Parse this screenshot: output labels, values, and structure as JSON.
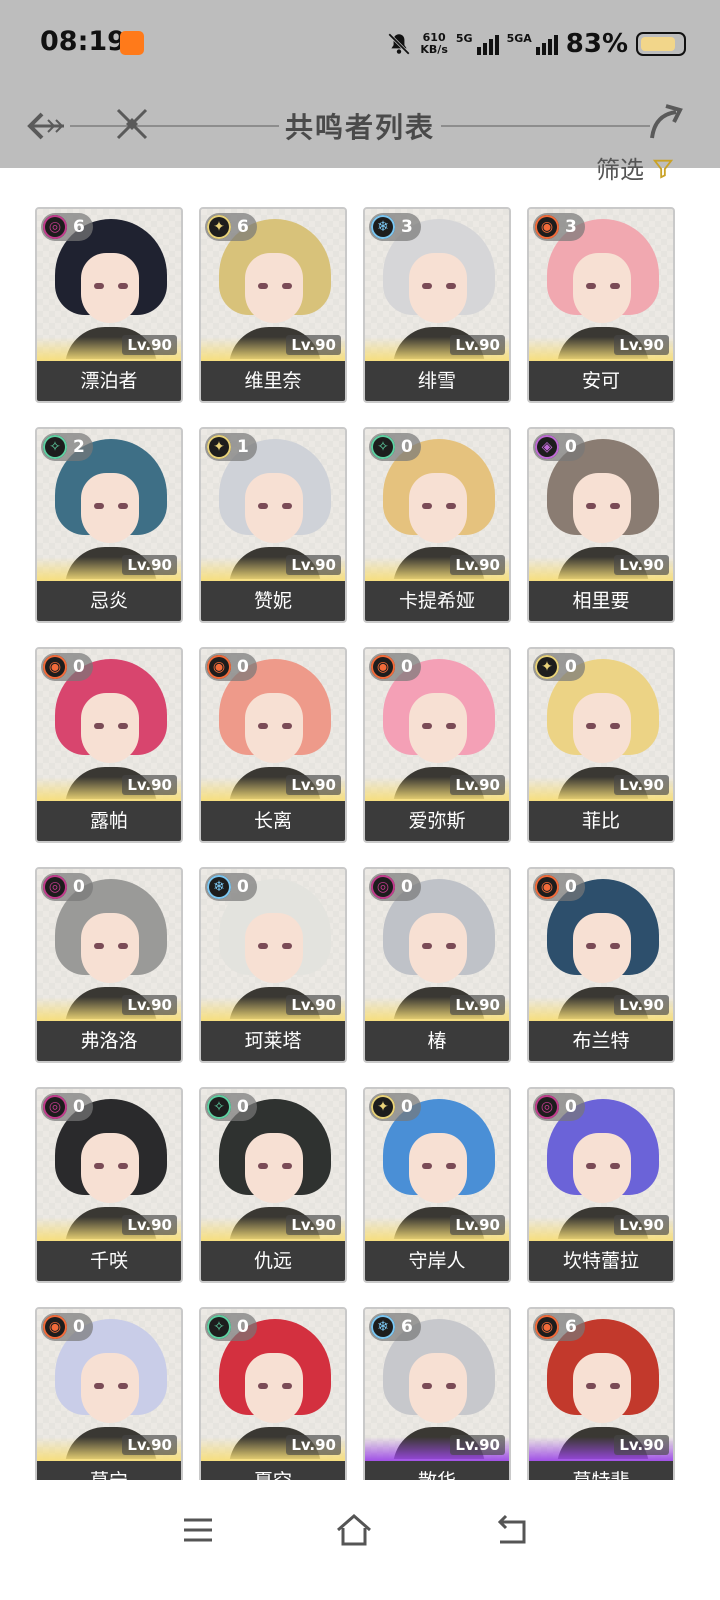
{
  "status_bar": {
    "time": "08:19",
    "net_speed": "610",
    "net_unit": "KB/s",
    "signal1_label": "5G",
    "signal2_label": "5GA",
    "battery_text": "83%",
    "icons": [
      "taobao-app-icon",
      "mute-bell-icon",
      "signal-icon",
      "battery-icon"
    ]
  },
  "header": {
    "title": "共鸣者列表",
    "filter_label": "筛选"
  },
  "level_prefix": "Lv.90",
  "attribute_colors": {
    "spectro": "#e8d27a",
    "glacio": "#7cc7f2",
    "fusion": "#f26b3a",
    "electro": "#c06bd6",
    "aero": "#5fd0a2",
    "havoc": "#c13c8c"
  },
  "characters": [
    {
      "name": "漂泊者",
      "attribute": "havoc",
      "chain": "6",
      "level": "Lv.90",
      "hair": "#1f2230",
      "rarity": "gold"
    },
    {
      "name": "维里奈",
      "attribute": "spectro",
      "chain": "6",
      "level": "Lv.90",
      "hair": "#d8c27a",
      "rarity": "gold"
    },
    {
      "name": "绯雪",
      "attribute": "glacio",
      "chain": "3",
      "level": "Lv.90",
      "hair": "#d6d6d8",
      "rarity": "gold"
    },
    {
      "name": "安可",
      "attribute": "fusion",
      "chain": "3",
      "level": "Lv.90",
      "hair": "#f1a8b0",
      "rarity": "gold"
    },
    {
      "name": "忌炎",
      "attribute": "aero",
      "chain": "2",
      "level": "Lv.90",
      "hair": "#3e6f86",
      "rarity": "gold"
    },
    {
      "name": "赞妮",
      "attribute": "spectro",
      "chain": "1",
      "level": "Lv.90",
      "hair": "#cfd2d8",
      "rarity": "gold"
    },
    {
      "name": "卡提希娅",
      "attribute": "aero",
      "chain": "0",
      "level": "Lv.90",
      "hair": "#e5c27e",
      "rarity": "gold"
    },
    {
      "name": "相里要",
      "attribute": "electro",
      "chain": "0",
      "level": "Lv.90",
      "hair": "#8a7c72",
      "rarity": "gold"
    },
    {
      "name": "露帕",
      "attribute": "fusion",
      "chain": "0",
      "level": "Lv.90",
      "hair": "#d8456e",
      "rarity": "gold"
    },
    {
      "name": "长离",
      "attribute": "fusion",
      "chain": "0",
      "level": "Lv.90",
      "hair": "#ee9a8a",
      "rarity": "gold"
    },
    {
      "name": "爱弥斯",
      "attribute": "fusion",
      "chain": "0",
      "level": "Lv.90",
      "hair": "#f4a0b6",
      "rarity": "gold"
    },
    {
      "name": "菲比",
      "attribute": "spectro",
      "chain": "0",
      "level": "Lv.90",
      "hair": "#ecd385",
      "rarity": "gold"
    },
    {
      "name": "弗洛洛",
      "attribute": "havoc",
      "chain": "0",
      "level": "Lv.90",
      "hair": "#9a9a98",
      "rarity": "gold"
    },
    {
      "name": "珂莱塔",
      "attribute": "glacio",
      "chain": "0",
      "level": "Lv.90",
      "hair": "#e3e3de",
      "rarity": "gold"
    },
    {
      "name": "椿",
      "attribute": "havoc",
      "chain": "0",
      "level": "Lv.90",
      "hair": "#bfc2c8",
      "rarity": "gold"
    },
    {
      "name": "布兰特",
      "attribute": "fusion",
      "chain": "0",
      "level": "Lv.90",
      "hair": "#2d4f6c",
      "rarity": "gold"
    },
    {
      "name": "千咲",
      "attribute": "havoc",
      "chain": "0",
      "level": "Lv.90",
      "hair": "#2a2a2c",
      "rarity": "gold"
    },
    {
      "name": "仇远",
      "attribute": "aero",
      "chain": "0",
      "level": "Lv.90",
      "hair": "#2f3230",
      "rarity": "gold"
    },
    {
      "name": "守岸人",
      "attribute": "spectro",
      "chain": "0",
      "level": "Lv.90",
      "hair": "#4a8fd6",
      "rarity": "gold"
    },
    {
      "name": "坎特蕾拉",
      "attribute": "havoc",
      "chain": "0",
      "level": "Lv.90",
      "hair": "#6b63d8",
      "rarity": "gold"
    },
    {
      "name": "莫宁",
      "attribute": "fusion",
      "chain": "0",
      "level": "Lv.90",
      "hair": "#c9cde8",
      "rarity": "gold"
    },
    {
      "name": "夏空",
      "attribute": "aero",
      "chain": "0",
      "level": "Lv.90",
      "hair": "#d3303f",
      "rarity": "gold"
    },
    {
      "name": "散华",
      "attribute": "glacio",
      "chain": "6",
      "level": "Lv.90",
      "hair": "#c7c8cc",
      "rarity": "purple"
    },
    {
      "name": "莫特斐",
      "attribute": "fusion",
      "chain": "6",
      "level": "Lv.90",
      "hair": "#c2392c",
      "rarity": "purple"
    }
  ],
  "nav_bar": {
    "buttons": [
      "menu-icon",
      "home-icon",
      "back-icon"
    ]
  }
}
